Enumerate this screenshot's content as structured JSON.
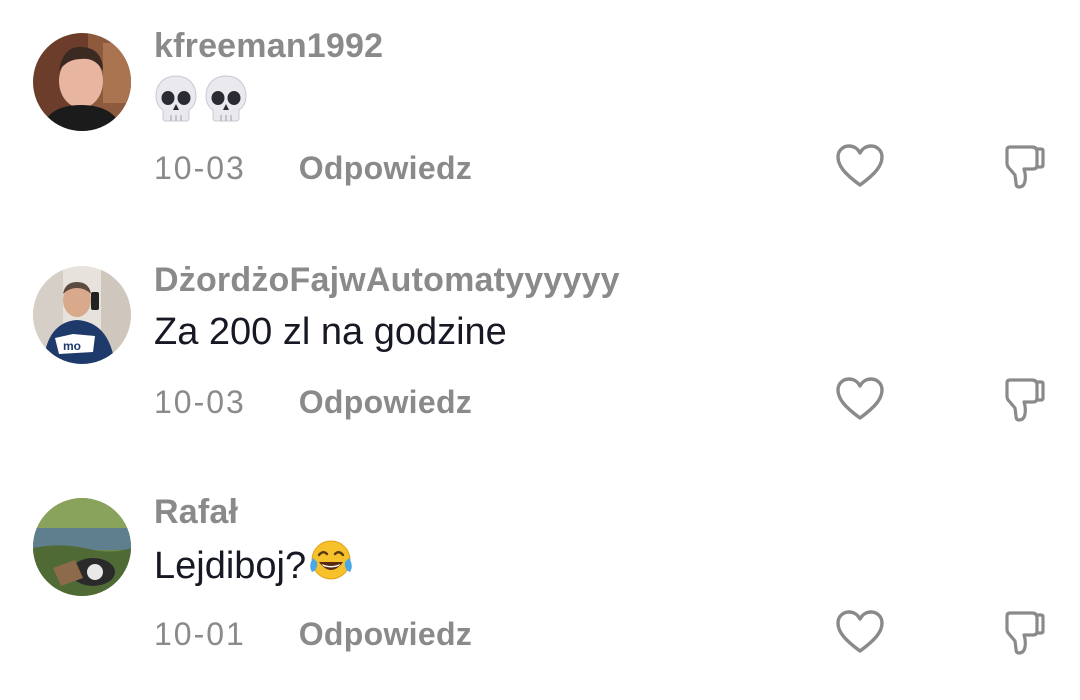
{
  "comments": [
    {
      "username": "kfreeman1992",
      "text": "",
      "emojis": [
        "skull",
        "skull"
      ],
      "date": "10-03",
      "reply_label": "Odpowiedz"
    },
    {
      "username": "DżordżoFajwAutomatyyyyyy",
      "text": "Za 200 zl na godzine",
      "date": "10-03",
      "reply_label": "Odpowiedz"
    },
    {
      "username": "Rafał",
      "text": "Lejdiboj?",
      "emojis": [
        "face-with-tears-of-joy"
      ],
      "date": "10-01",
      "reply_label": "Odpowiedz"
    }
  ],
  "colors": {
    "muted": "#8a8a8a",
    "text": "#161823",
    "icon_stroke": "#8a8a8a"
  }
}
